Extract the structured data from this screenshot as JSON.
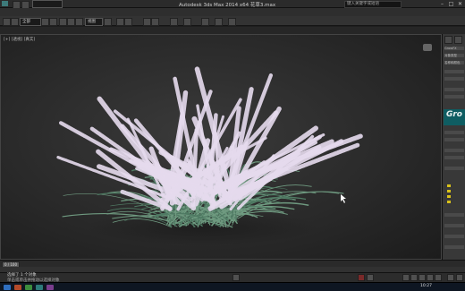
{
  "window": {
    "title": "Autodesk 3ds Max 2014 x64    花草3.max",
    "search_placeholder": "键入关键字或短语",
    "minimize": "–",
    "maximize": "□",
    "close": "✕"
  },
  "toolbar": {
    "selection_filter": "全部",
    "view_dropdown": "视图"
  },
  "viewport": {
    "label": "[+] [透视] [真实]"
  },
  "command_panel": {
    "rows": [
      "GrowFX",
      "对象类型",
      "名称和颜色"
    ],
    "plugin_logo": "Gro",
    "checklist_count": 4
  },
  "status": {
    "selected": "选择了 1 个对象",
    "hint": "单击或单击并拖动以选择对象",
    "time_label": "0 / 100"
  },
  "taskbar": {
    "clock": "10:27"
  },
  "colors": {
    "viewport_bg": "#2a2a2a",
    "foliage": "#6f9a80",
    "flower": "#e6dbee",
    "plugin_bg": "#0f5d62"
  }
}
